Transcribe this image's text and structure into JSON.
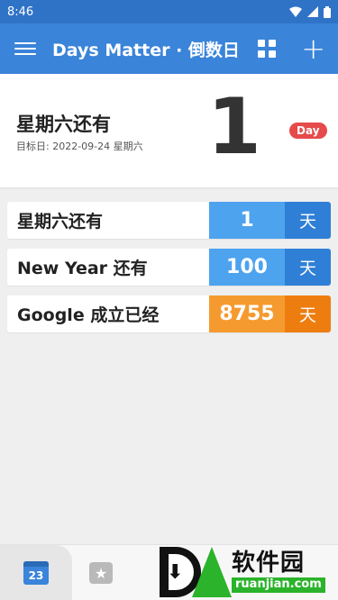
{
  "status": {
    "time": "8:46"
  },
  "appbar": {
    "title": "Days Matter · 倒数日"
  },
  "hero": {
    "title": "星期六还有",
    "subtitle": "目标日: 2022-09-24 星期六",
    "number": "1",
    "badge": "Day"
  },
  "events": [
    {
      "label": "星期六还有",
      "number": "1",
      "unit": "天",
      "num_color": "#4da3ee",
      "unit_color": "#2f7fd6"
    },
    {
      "label": "New Year 还有",
      "number": "100",
      "unit": "天",
      "num_color": "#4da3ee",
      "unit_color": "#2f7fd6"
    },
    {
      "label": "Google 成立已经",
      "number": "8755",
      "unit": "天",
      "num_color": "#f59a2f",
      "unit_color": "#ee7d0f"
    }
  ],
  "bottombar": {
    "tab1_icon": "calendar-icon",
    "tab1_text": "23",
    "tab2_icon": "star-icon"
  },
  "watermark": {
    "cn": "软件园",
    "domain": "ruanjian.com"
  }
}
